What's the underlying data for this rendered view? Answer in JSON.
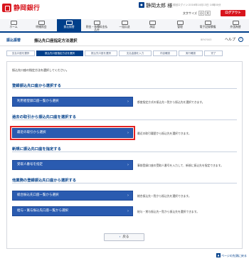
{
  "header": {
    "bank_name": "静岡銀行",
    "user_name": "静岡太郎 様",
    "login_time": "前回ログイン:2016年10月13日 10時00分",
    "site_label": "文字サイズ",
    "font_small": "小",
    "font_large": "大",
    "logout": "ログアウト"
  },
  "nav": {
    "items": [
      {
        "label": "ホーム"
      },
      {
        "label": "明細照会"
      },
      {
        "label": "振込振替"
      },
      {
        "label": "税金・各種料金払込み"
      },
      {
        "label": "一括伝送"
      },
      {
        "label": "承認"
      },
      {
        "label": "管理"
      },
      {
        "label": "電子記録債権"
      },
      {
        "label": "外国為替"
      }
    ]
  },
  "page": {
    "category": "振込振替",
    "title": "振込先口座指定方法選択",
    "screen_id": "BFKF003",
    "help": "ヘルプ",
    "intro": "振込先口座の指定方法を選択してください。"
  },
  "steps": [
    "支払口座を選択",
    "振込先口座指定方法を選択",
    "振込先口座を選択",
    "支払金額を入力",
    "内容確認",
    "実行確認",
    "完了"
  ],
  "sections": [
    {
      "heading": "登録振込先口座から選択する",
      "buttons": [
        {
          "label": "利用者登録口座一覧から選択",
          "desc": "都度指定方式の振込先一覧から振込先を選択できます。",
          "highlight": false
        }
      ]
    },
    {
      "heading": "過去の取引から振込先口座を選択する",
      "buttons": [
        {
          "label": "最近の取引から選択",
          "desc": "最近の取引履歴から振込先を選択できます。",
          "highlight": true
        }
      ]
    },
    {
      "heading": "新規に振込先口座を指定する",
      "buttons": [
        {
          "label": "受取人番号を指定",
          "desc": "事前登録口座の受取人番号を入力して、新規に振込先を指定できます。",
          "highlight": false
        }
      ]
    },
    {
      "heading": "他業務の登録振込先口座から選択する",
      "buttons": [
        {
          "label": "総合振込先口座一覧から選択",
          "desc": "総合振込先一覧から振込先を選択できます。",
          "highlight": false
        },
        {
          "label": "給与・賞与振込先口座一覧から選択",
          "desc": "給与・賞与振込先一覧から振込先を選択できます。",
          "highlight": false
        }
      ]
    }
  ],
  "footer": {
    "back": "戻る",
    "pagetop": "ページの先頭に戻る"
  },
  "colors": {
    "brand": "#d8141c",
    "primary": "#003f8a",
    "button": "#2a5bb0",
    "highlight": "#e52321"
  }
}
